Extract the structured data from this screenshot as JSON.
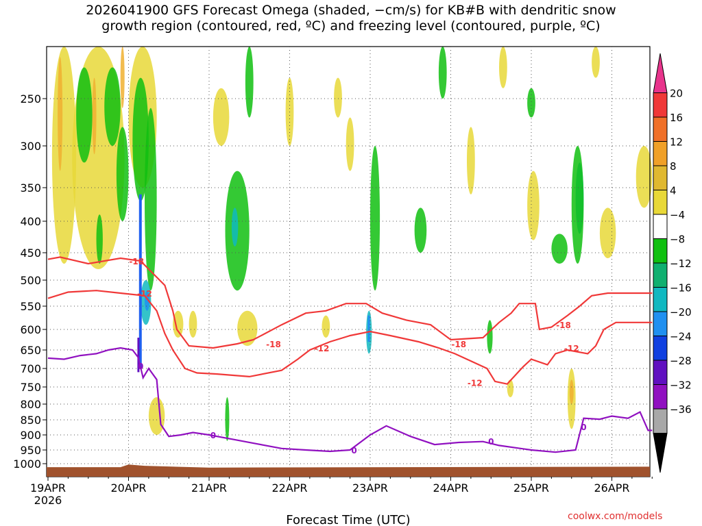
{
  "title": {
    "line1": "2026041900 GFS Forecast Omega (shaded, −cm/s) for KB#B with dendritic snow",
    "line2": "growth region (contoured, red, ºC) and freezing level (contoured, purple, ºC)"
  },
  "credit": "coolwx.com/models",
  "chart_data": {
    "type": "time-height cross section",
    "xlabel": "Forecast Time (UTC)",
    "x_ticks": [
      {
        "label": "19APR",
        "sub": "2026",
        "day": 0
      },
      {
        "label": "20APR",
        "day": 1
      },
      {
        "label": "21APR",
        "day": 2
      },
      {
        "label": "22APR",
        "day": 3
      },
      {
        "label": "23APR",
        "day": 4
      },
      {
        "label": "24APR",
        "day": 5
      },
      {
        "label": "25APR",
        "day": 6
      },
      {
        "label": "26APR",
        "day": 7
      }
    ],
    "xlim_days": [
      0,
      7.5
    ],
    "y_ticks": [
      250,
      300,
      350,
      400,
      450,
      500,
      550,
      600,
      650,
      700,
      750,
      800,
      850,
      900,
      950,
      1000
    ],
    "y_scale": "pressure (hPa), inverted",
    "ylim_hpa": [
      200,
      1030
    ],
    "grid": "dotted",
    "colorbar": {
      "labels": [
        "20",
        "16",
        "12",
        "8",
        "4",
        "−4",
        "−8",
        "−12",
        "−16",
        "−20",
        "−24",
        "−28",
        "−32",
        "−36"
      ],
      "colors": [
        "#e8348c",
        "#f03838",
        "#f07028",
        "#f0a028",
        "#e0b830",
        "#e8d838",
        "#ffffff",
        "#10c010",
        "#10b070",
        "#10b8c0",
        "#2090f0",
        "#1040e0",
        "#6010c0",
        "#9010c0",
        "#a8a8a8",
        "#000000"
      ]
    },
    "contours": [
      {
        "name": "−18",
        "color": "#f03838",
        "label": "-18",
        "points": [
          [
            0,
            462
          ],
          [
            0.15,
            458
          ],
          [
            0.5,
            470
          ],
          [
            0.9,
            460
          ],
          [
            1.15,
            465
          ],
          [
            1.25,
            480
          ],
          [
            1.45,
            510
          ],
          [
            1.55,
            560
          ],
          [
            1.6,
            600
          ],
          [
            1.75,
            640
          ],
          [
            2.05,
            645
          ],
          [
            2.35,
            635
          ],
          [
            2.55,
            625
          ],
          [
            2.9,
            590
          ],
          [
            3.2,
            565
          ],
          [
            3.45,
            560
          ],
          [
            3.7,
            545
          ],
          [
            3.95,
            545
          ],
          [
            4.15,
            565
          ],
          [
            4.45,
            580
          ],
          [
            4.75,
            590
          ],
          [
            5.0,
            625
          ],
          [
            5.4,
            620
          ],
          [
            5.6,
            585
          ],
          [
            5.75,
            565
          ],
          [
            5.85,
            545
          ],
          [
            6.05,
            545
          ],
          [
            6.1,
            600
          ],
          [
            6.25,
            595
          ],
          [
            6.45,
            570
          ],
          [
            6.6,
            550
          ],
          [
            6.75,
            530
          ],
          [
            6.95,
            525
          ],
          [
            7.5,
            525
          ]
        ],
        "label_at": [
          [
            1.1,
            465
          ],
          [
            2.8,
            635
          ],
          [
            5.1,
            635
          ],
          [
            6.4,
            590
          ]
        ]
      },
      {
        "name": "−12",
        "color": "#f03838",
        "label": "-12",
        "points": [
          [
            0,
            535
          ],
          [
            0.25,
            523
          ],
          [
            0.6,
            520
          ],
          [
            0.9,
            525
          ],
          [
            1.2,
            530
          ],
          [
            1.35,
            560
          ],
          [
            1.45,
            610
          ],
          [
            1.55,
            650
          ],
          [
            1.7,
            700
          ],
          [
            1.85,
            712
          ],
          [
            2.1,
            715
          ],
          [
            2.5,
            722
          ],
          [
            2.9,
            705
          ],
          [
            3.1,
            675
          ],
          [
            3.25,
            650
          ],
          [
            3.5,
            630
          ],
          [
            3.75,
            615
          ],
          [
            4.0,
            605
          ],
          [
            4.25,
            615
          ],
          [
            4.6,
            630
          ],
          [
            4.85,
            645
          ],
          [
            5.05,
            660
          ],
          [
            5.3,
            685
          ],
          [
            5.45,
            700
          ],
          [
            5.55,
            735
          ],
          [
            5.7,
            742
          ],
          [
            5.9,
            695
          ],
          [
            6.0,
            675
          ],
          [
            6.2,
            690
          ],
          [
            6.3,
            660
          ],
          [
            6.45,
            650
          ],
          [
            6.7,
            660
          ],
          [
            6.8,
            640
          ],
          [
            6.9,
            600
          ],
          [
            7.05,
            585
          ],
          [
            7.5,
            585
          ]
        ],
        "label_at": [
          [
            1.2,
            525
          ],
          [
            3.4,
            645
          ],
          [
            5.3,
            738
          ],
          [
            6.5,
            645
          ]
        ]
      },
      {
        "name": "0",
        "color": "#9010c0",
        "label": "0",
        "points": [
          [
            0,
            672
          ],
          [
            0.2,
            675
          ],
          [
            0.4,
            665
          ],
          [
            0.6,
            660
          ],
          [
            0.75,
            650
          ],
          [
            0.9,
            645
          ],
          [
            1.05,
            650
          ],
          [
            1.12,
            670
          ],
          [
            1.18,
            725
          ],
          [
            1.25,
            700
          ],
          [
            1.35,
            730
          ],
          [
            1.4,
            865
          ],
          [
            1.5,
            905
          ],
          [
            1.65,
            900
          ],
          [
            1.8,
            892
          ],
          [
            2.0,
            900
          ],
          [
            2.3,
            915
          ],
          [
            2.6,
            930
          ],
          [
            2.9,
            945
          ],
          [
            3.2,
            950
          ],
          [
            3.5,
            955
          ],
          [
            3.75,
            950
          ],
          [
            4.0,
            900
          ],
          [
            4.2,
            870
          ],
          [
            4.5,
            905
          ],
          [
            4.8,
            932
          ],
          [
            5.1,
            925
          ],
          [
            5.4,
            922
          ],
          [
            5.6,
            935
          ],
          [
            6.0,
            950
          ],
          [
            6.3,
            958
          ],
          [
            6.55,
            950
          ],
          [
            6.65,
            845
          ],
          [
            6.85,
            848
          ],
          [
            7.0,
            838
          ],
          [
            7.2,
            845
          ],
          [
            7.35,
            825
          ],
          [
            7.45,
            885
          ],
          [
            7.5,
            885
          ]
        ],
        "label_at": [
          [
            1.15,
            693
          ],
          [
            2.05,
            900
          ],
          [
            3.8,
            950
          ],
          [
            5.5,
            920
          ],
          [
            6.65,
            873
          ]
        ]
      }
    ]
  }
}
